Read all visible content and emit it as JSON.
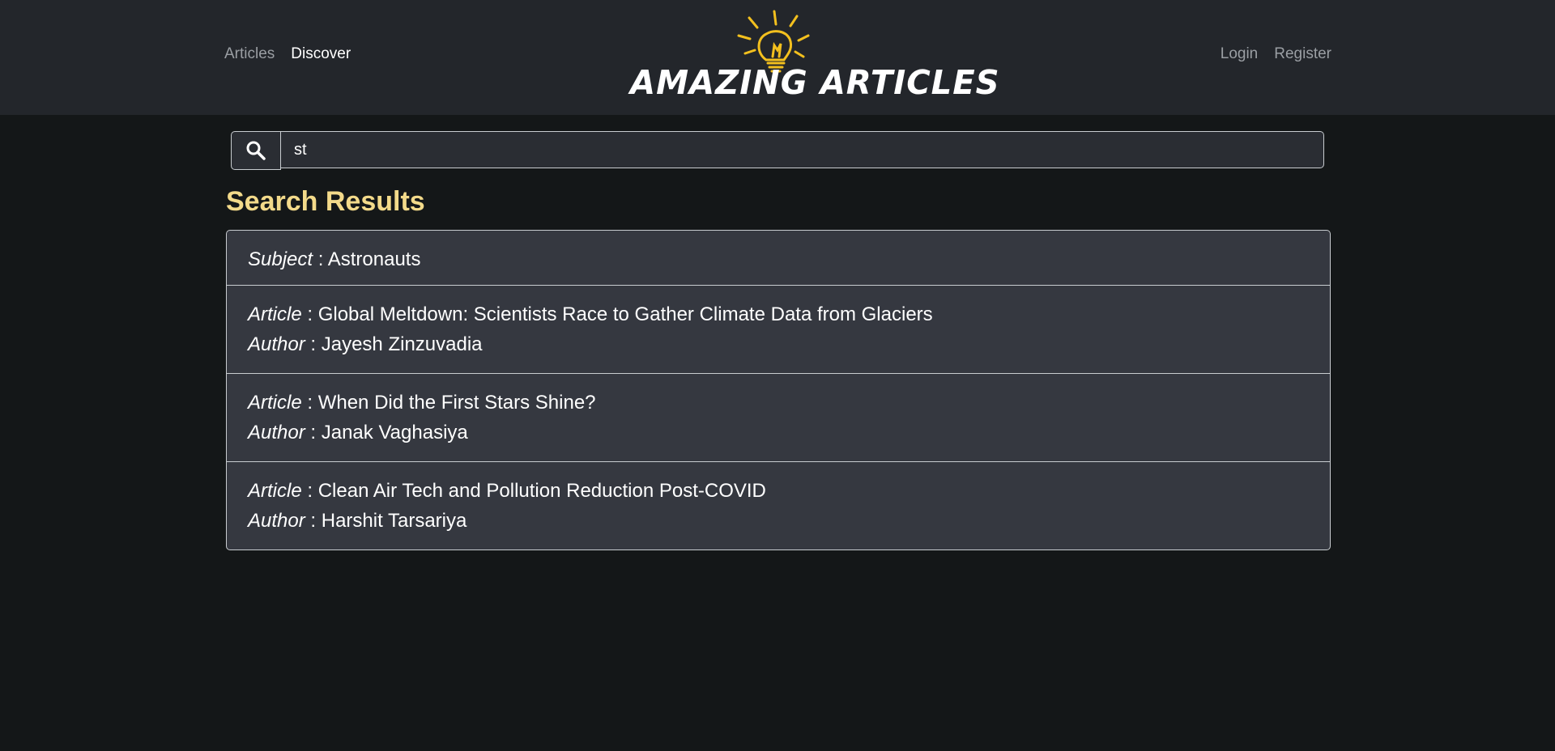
{
  "nav": {
    "left": [
      {
        "label": "Articles",
        "active": false
      },
      {
        "label": "Discover",
        "active": true
      }
    ],
    "right": [
      {
        "label": "Login"
      },
      {
        "label": "Register"
      }
    ]
  },
  "brand": {
    "name": "AMAZING ARTICLES",
    "icon": "lightbulb-icon",
    "accent_color": "#f3c01e"
  },
  "search": {
    "value": "st",
    "icon": "search-icon"
  },
  "results": {
    "title": "Search Results",
    "items": [
      {
        "type": "subject",
        "label": "Subject",
        "sep": " : ",
        "value": "Astronauts"
      },
      {
        "type": "article",
        "label": "Article",
        "sep": " : ",
        "value": "Global Meltdown: Scientists Race to Gather Climate Data from Glaciers",
        "author_label": "Author",
        "author": "Jayesh Zinzuvadia"
      },
      {
        "type": "article",
        "label": "Article",
        "sep": " : ",
        "value": "When Did the First Stars Shine?",
        "author_label": "Author",
        "author": "Janak Vaghasiya"
      },
      {
        "type": "article",
        "label": "Article",
        "sep": " : ",
        "value": "Clean Air Tech and Pollution Reduction Post-COVID",
        "author_label": "Author",
        "author": "Harshit Tarsariya"
      }
    ]
  },
  "colors": {
    "navbar": "#23262b",
    "background": "#141718",
    "heading": "#f3da8a",
    "card": "#353840"
  }
}
